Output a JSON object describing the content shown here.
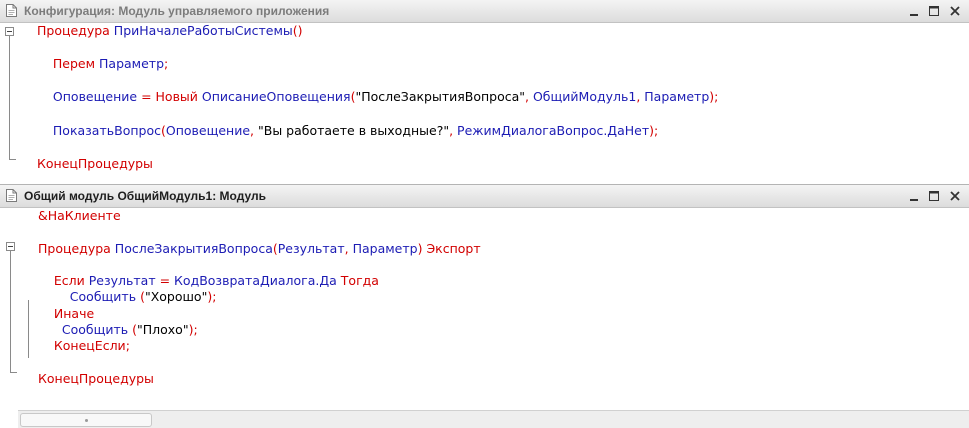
{
  "windows": [
    {
      "title": "Конфигурация: Модуль управляемого приложения",
      "lines": [
        [
          [
            "kw",
            "Процедура "
          ],
          [
            "id",
            "ПриНачалеРаботыСистемы"
          ],
          [
            "pn",
            "()"
          ]
        ],
        [],
        [
          [
            "tx",
            "    "
          ],
          [
            "kw",
            "Перем "
          ],
          [
            "id",
            "Параметр"
          ],
          [
            "pn",
            ";"
          ]
        ],
        [],
        [
          [
            "tx",
            "    "
          ],
          [
            "id",
            "Оповещение "
          ],
          [
            "pn",
            "= "
          ],
          [
            "kw",
            "Новый "
          ],
          [
            "id",
            "ОписаниеОповещения"
          ],
          [
            "pn",
            "("
          ],
          [
            "tx",
            "\"ПослеЗакрытияВопроса\""
          ],
          [
            "pn",
            ", "
          ],
          [
            "id",
            "ОбщийМодуль1"
          ],
          [
            "pn",
            ", "
          ],
          [
            "id",
            "Параметр"
          ],
          [
            "pn",
            ");"
          ]
        ],
        [],
        [
          [
            "tx",
            "    "
          ],
          [
            "id",
            "ПоказатьВопрос"
          ],
          [
            "pn",
            "("
          ],
          [
            "id",
            "Оповещение"
          ],
          [
            "pn",
            ", "
          ],
          [
            "tx",
            "\"Вы работаете в выходные?\""
          ],
          [
            "pn",
            ", "
          ],
          [
            "id",
            "РежимДиалогаВопрос.ДаНет"
          ],
          [
            "pn",
            ");"
          ]
        ],
        [],
        [
          [
            "kw",
            "КонецПроцедуры"
          ]
        ]
      ]
    },
    {
      "title": "Общий модуль ОбщийМодуль1: Модуль",
      "lines": [
        [
          [
            "kw",
            "&НаКлиенте"
          ]
        ],
        [],
        [
          [
            "kw",
            "Процедура "
          ],
          [
            "id",
            "ПослеЗакрытияВопроса"
          ],
          [
            "pn",
            "("
          ],
          [
            "id",
            "Результат"
          ],
          [
            "pn",
            ", "
          ],
          [
            "id",
            "Параметр"
          ],
          [
            "pn",
            ") "
          ],
          [
            "kw",
            "Экспорт"
          ]
        ],
        [],
        [
          [
            "tx",
            "    "
          ],
          [
            "kw",
            "Если "
          ],
          [
            "id",
            "Результат "
          ],
          [
            "pn",
            "= "
          ],
          [
            "id",
            "КодВозвратаДиалога.Да "
          ],
          [
            "kw",
            "Тогда"
          ]
        ],
        [
          [
            "tx",
            "        "
          ],
          [
            "id",
            "Сообщить "
          ],
          [
            "pn",
            "("
          ],
          [
            "tx",
            "\"Хорошо\""
          ],
          [
            "pn",
            ");"
          ]
        ],
        [
          [
            "tx",
            "    "
          ],
          [
            "kw",
            "Иначе"
          ]
        ],
        [
          [
            "tx",
            "      "
          ],
          [
            "id",
            "Сообщить "
          ],
          [
            "pn",
            "("
          ],
          [
            "tx",
            "\"Плохо\""
          ],
          [
            "pn",
            ");"
          ]
        ],
        [
          [
            "tx",
            "    "
          ],
          [
            "kw",
            "КонецЕсли"
          ],
          [
            "pn",
            ";"
          ]
        ],
        [],
        [
          [
            "kw",
            "КонецПроцедуры"
          ]
        ]
      ]
    }
  ],
  "colors": {
    "keyword": "#d20000",
    "identifier": "#1c1cb4",
    "text": "#000000"
  },
  "icons": [
    "document-icon",
    "minimize-icon",
    "maximize-icon",
    "close-icon",
    "fold-toggle-icon"
  ]
}
